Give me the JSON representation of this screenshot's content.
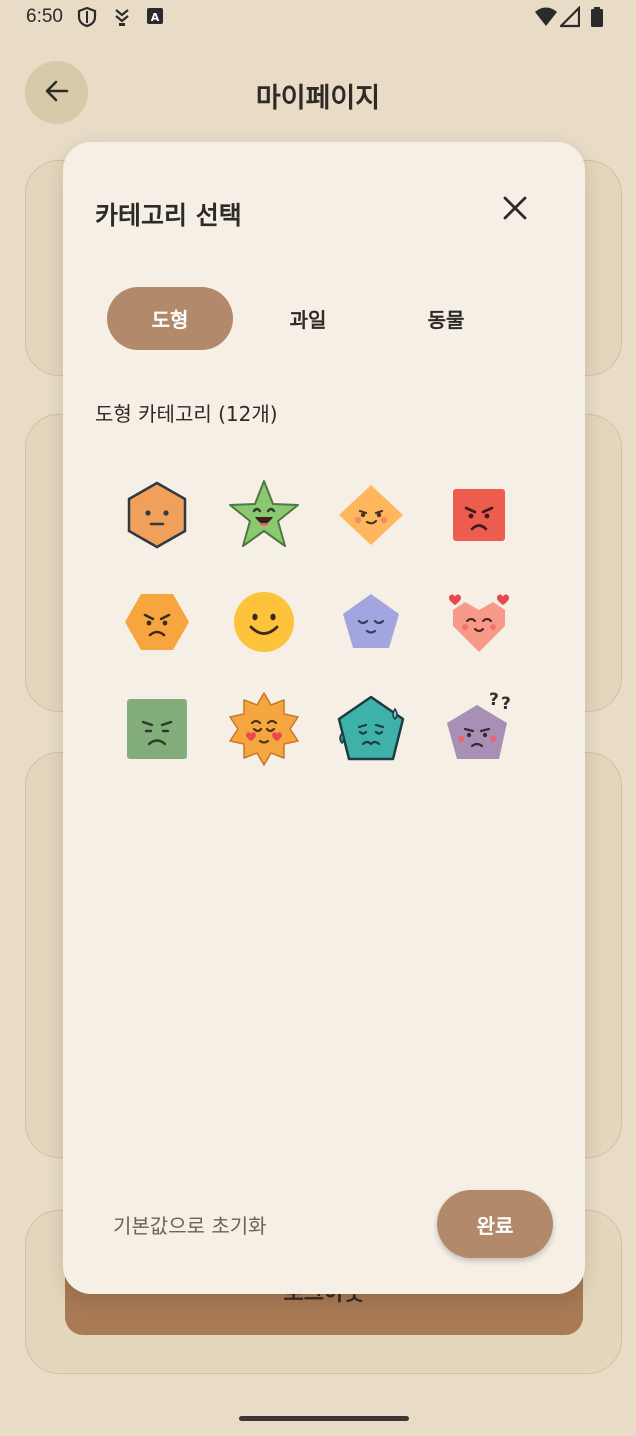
{
  "status_bar": {
    "time": "6:50",
    "left_icons": [
      "shield-icon",
      "download-icon",
      "accessibility-icon"
    ],
    "right_icons": [
      "wifi-icon",
      "signal-icon",
      "battery-icon"
    ]
  },
  "app_bar": {
    "title": "마이페이지",
    "back_icon": "arrow-left-icon"
  },
  "background": {
    "logout_label": "로그아웃"
  },
  "dialog": {
    "title": "카테고리 선택",
    "close_icon": "close-icon",
    "tabs": [
      {
        "label": "도형",
        "active": true
      },
      {
        "label": "과일",
        "active": false
      },
      {
        "label": "동물",
        "active": false
      }
    ],
    "section_label": "도형 카테고리 (12개)",
    "emojis": [
      {
        "name": "hexagon-neutral-face-icon",
        "color": "#f0a05a"
      },
      {
        "name": "star-laughing-face-icon",
        "color": "#8cc872"
      },
      {
        "name": "diamond-smirk-face-icon",
        "color": "#ffb75e"
      },
      {
        "name": "square-angry-face-icon",
        "color": "#ee5b4f"
      },
      {
        "name": "hexagon-angry-face-icon",
        "color": "#f7a53f"
      },
      {
        "name": "circle-smile-face-icon",
        "color": "#fdc33a"
      },
      {
        "name": "pentagon-calm-face-icon",
        "color": "#a3a5e0"
      },
      {
        "name": "heart-love-face-icon",
        "color": "#f99a88"
      },
      {
        "name": "square-sad-face-icon",
        "color": "#82ad7a"
      },
      {
        "name": "sun-love-face-icon",
        "color": "#f5a63f"
      },
      {
        "name": "pentagon-worried-face-icon",
        "color": "#3eb2a8"
      },
      {
        "name": "pentagon-confused-face-icon",
        "color": "#a890b4"
      }
    ],
    "reset_label": "기본값으로 초기화",
    "done_label": "완료"
  },
  "colors": {
    "background": "#e8dcc6",
    "dialog": "#f5efe6",
    "accent": "#b28a6b",
    "logout": "#a87a55"
  }
}
